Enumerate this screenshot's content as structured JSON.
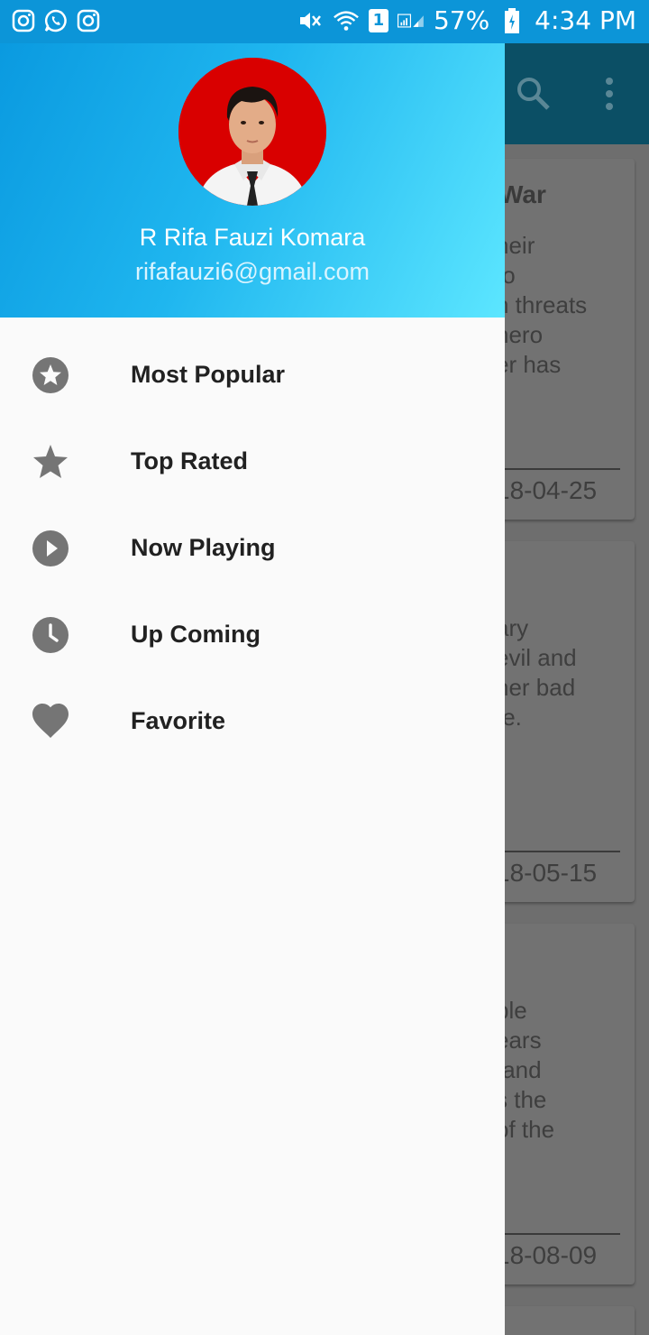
{
  "status_bar": {
    "battery": "57%",
    "time": "4:34 PM",
    "sim_slot": "1",
    "left_icons": [
      "instagram-icon",
      "whatsapp-icon",
      "instagram-icon"
    ],
    "right_icons": [
      "mute-icon",
      "wifi-icon",
      "sim-icon",
      "signal-icon",
      "battery-icon"
    ]
  },
  "colors": {
    "status_bar": "#0c95d8",
    "header_gradient_start": "#0a9ae0",
    "header_gradient_end": "#5ce6ff",
    "toolbar_dimmed": "#0b4f65",
    "menu_icon": "#757575",
    "menu_text": "#212121"
  },
  "drawer": {
    "profile": {
      "name": "R Rifa Fauzi Komara",
      "email": "rifafauzi6@gmail.com"
    },
    "menu": [
      {
        "label": "Most Popular",
        "icon": "star-circle-icon"
      },
      {
        "label": "Top Rated",
        "icon": "star-icon"
      },
      {
        "label": "Now Playing",
        "icon": "play-circle-icon"
      },
      {
        "label": "Up Coming",
        "icon": "clock-icon"
      },
      {
        "label": "Favorite",
        "icon": "heart-icon"
      }
    ]
  },
  "background_cards": [
    {
      "title": "War",
      "text": "heir\nto\nn threats\nhero\ner has",
      "date": "18-04-25"
    },
    {
      "title": "",
      "text": "ary\nevil and\nher bad\nfe.",
      "date": "18-05-15"
    },
    {
      "title": "",
      "text": "ble\nears\n and\ns the\nof the",
      "date": "18-08-09"
    }
  ]
}
